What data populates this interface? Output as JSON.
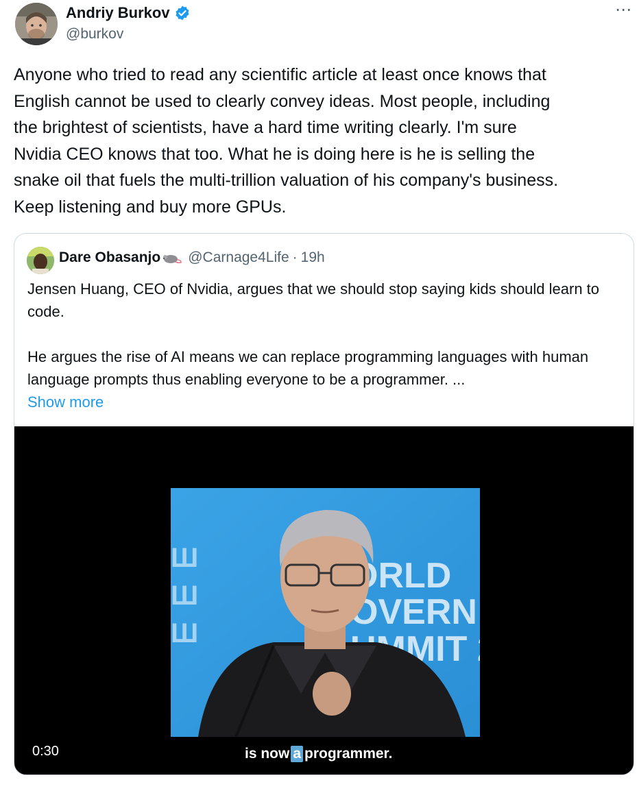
{
  "author": {
    "name": "Andriy Burkov",
    "handle": "@burkov",
    "verified_icon": "verified-badge-icon",
    "verified_color": "#1d9bf0"
  },
  "more_icon": "⋯",
  "tweet_text": "Anyone who tried to read any scientific article at least once knows that\nEnglish cannot be used to clearly convey ideas. Most people, including\nthe brightest of scientists, have a hard time writing clearly. I'm sure\nNvidia CEO knows that too. What he is doing here is he is selling the\nsnake oil that fuels the multi-trillion valuation of his company's business.\nKeep listening and buy more GPUs.",
  "quote": {
    "name": "Dare Obasanjo",
    "emoji_icon": "rat-icon",
    "handle": "@Carnage4Life",
    "separator": "·",
    "time": "19h",
    "paragraph1": "Jensen Huang, CEO of Nvidia, argues that we should stop saying kids should learn to code.",
    "paragraph2": "He argues the rise of AI means we can replace programming languages with human language prompts thus enabling everyone to be a programmer. ...",
    "show_more": "Show more",
    "link_color": "#1d9bf0",
    "video": {
      "duration": "0:30",
      "caption_before": "is now",
      "caption_highlight": "a",
      "caption_after": "programmer.",
      "backdrop_text": "ORLD\nOVERN\nUMMIT 2"
    }
  }
}
